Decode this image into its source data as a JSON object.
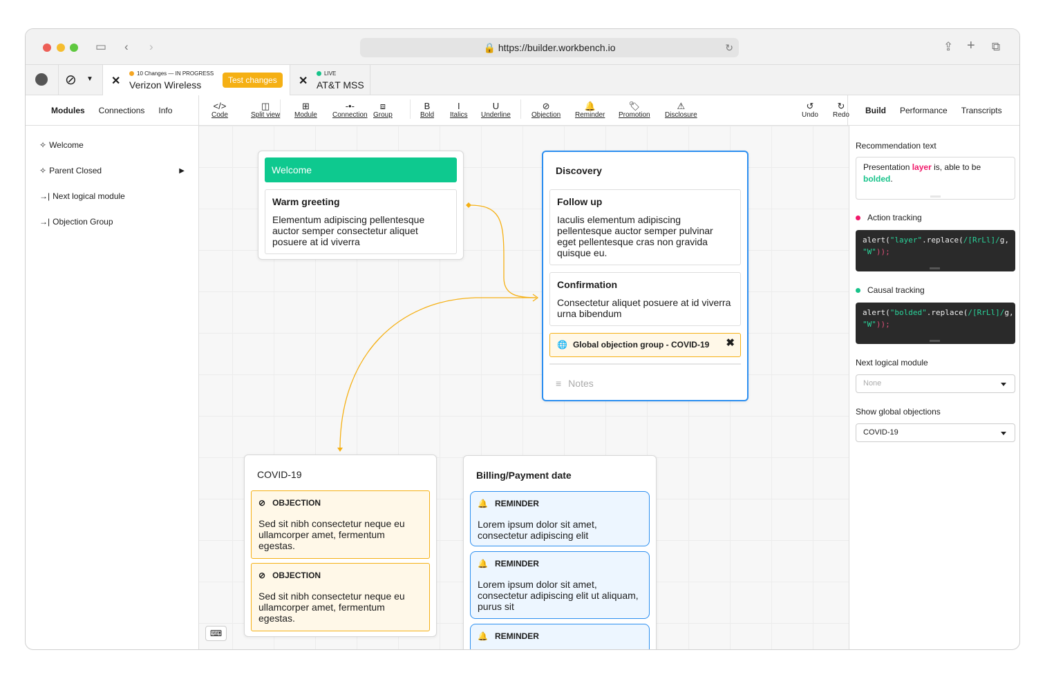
{
  "browser": {
    "url": "https://builder.workbench.io"
  },
  "tabs": [
    {
      "status": "10 Changes — IN PROGRESS",
      "title": "Verizon Wireless",
      "button": "Test changes",
      "status_color": "#f5a623"
    },
    {
      "status": "LIVE",
      "title": "AT&T MSS",
      "status_color": "#17c38a"
    }
  ],
  "left_nav": {
    "tabs": [
      "Modules",
      "Connections",
      "Info"
    ],
    "items": [
      {
        "label": "Welcome",
        "icon": "sparkle-icon"
      },
      {
        "label": "Parent Closed",
        "icon": "sparkle-icon"
      },
      {
        "label": "Next logical module",
        "icon": "arrow-to-line-icon"
      },
      {
        "label": "Objection Group",
        "icon": "arrow-to-line-icon"
      }
    ]
  },
  "toolbar": {
    "tools": [
      {
        "label": "Code",
        "glyph": "</>"
      },
      {
        "label": "Split view",
        "glyph": "◫"
      },
      {
        "label": "Module",
        "glyph": "⊞"
      },
      {
        "label": "Connection",
        "glyph": "-•-"
      },
      {
        "label": "Group",
        "glyph": "⧈"
      },
      {
        "label": "Bold",
        "glyph": "B"
      },
      {
        "label": "Italics",
        "glyph": "I"
      },
      {
        "label": "Underline",
        "glyph": "U"
      },
      {
        "label": "Objection",
        "glyph": "⊘"
      },
      {
        "label": "Reminder",
        "glyph": "🔔"
      },
      {
        "label": "Promotion",
        "glyph": "🏷"
      },
      {
        "label": "Disclosure",
        "glyph": "⚠"
      }
    ],
    "undo": "Undo",
    "redo": "Redo"
  },
  "right_nav": {
    "tabs": [
      "Build",
      "Performance",
      "Transcripts"
    ]
  },
  "canvas": {
    "welcome": {
      "title": "Welcome",
      "items": [
        {
          "title": "Warm greeting",
          "body": "Elementum adipiscing pellentesque auctor semper consectetur aliquet posuere at id viverra"
        }
      ]
    },
    "discovery": {
      "title": "Discovery",
      "items": [
        {
          "title": "Follow up",
          "body": "Iaculis elementum adipiscing pellentesque auctor semper pulvinar eget pellentesque cras non gravida quisque eu."
        },
        {
          "title": "Confirmation",
          "body": "Consectetur aliquet posuere at id viverra urna bibendum"
        }
      ],
      "global_objection": "Global objection group - COVID-19",
      "notes_placeholder": "Notes"
    },
    "covid": {
      "title": "COVID-19",
      "items": [
        {
          "tag": "OBJECTION",
          "body": "Sed sit nibh consectetur neque eu ullamcorper amet, fermentum egestas."
        },
        {
          "tag": "OBJECTION",
          "body": "Sed sit nibh consectetur neque eu ullamcorper amet, fermentum egestas."
        }
      ]
    },
    "billing": {
      "title": "Billing/Payment date",
      "items": [
        {
          "tag": "REMINDER",
          "body": "Lorem ipsum dolor sit amet, consectetur adipiscing elit"
        },
        {
          "tag": "REMINDER",
          "body": "Lorem ipsum dolor sit amet, consectetur adipiscing elit ut aliquam, purus sit"
        },
        {
          "tag": "REMINDER",
          "body": ""
        }
      ]
    }
  },
  "panel": {
    "recommendation_label": "Recommendation text",
    "recommendation": {
      "pre": "Presentation ",
      "hl1": "layer",
      "mid": " is, able to be ",
      "hl2": "bolded",
      "post": "."
    },
    "action_label": "Action tracking",
    "action_code": {
      "a": "alert(",
      "s": "\"layer\"",
      "b": ".replace(",
      "r": "/[RrLl]/",
      "g": "g,",
      "w": "\"W\"",
      "e": "));"
    },
    "causal_label": "Causal tracking",
    "causal_code": {
      "a": "alert(",
      "s": "\"bolded\"",
      "b": ".replace(",
      "r": "/[RrLl]/",
      "g": "g,",
      "w": "\"W\"",
      "e": "));"
    },
    "next_label": "Next logical module",
    "next_value": "None",
    "global_label": "Show global objections",
    "global_value": "COVID-19",
    "colors": {
      "pink": "#f0186a",
      "green": "#17c38a"
    }
  }
}
